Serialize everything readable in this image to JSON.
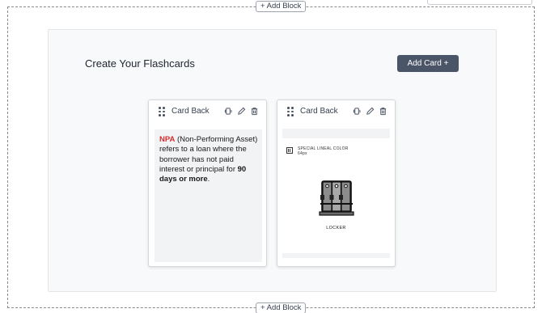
{
  "builder": {
    "add_block_top": "+ Add Block",
    "add_block_bottom": "+ Add Block"
  },
  "panel": {
    "title": "Create Your Flashcards",
    "add_card_label": "Add Card +"
  },
  "cards": [
    {
      "label": "Card Back",
      "content": {
        "highlight": "NPA",
        "text_1": " (Non-Performing Asset) refers to a loan where the borrower has not paid interest or principal for ",
        "bold": "90 days or more",
        "text_2": "."
      }
    },
    {
      "label": "Card Back",
      "image": {
        "meta_line_1": "SPECIAL LINEAL COLOR",
        "meta_line_2": "64px",
        "caption": "LOCKER"
      }
    }
  ],
  "icons": [
    "drag-handle-icon",
    "rotate-icon",
    "pencil-icon",
    "trash-icon",
    "locker-icon"
  ],
  "colors": {
    "accent_button": "#4a5568",
    "highlight_red": "#d32f2f",
    "panel_bg": "#f8f9fa"
  }
}
